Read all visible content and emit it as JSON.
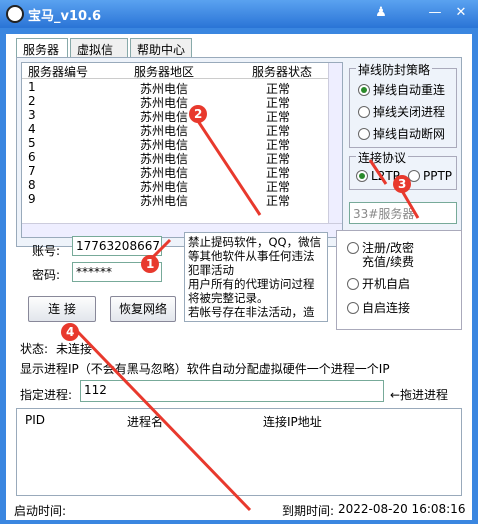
{
  "window": {
    "title": "宝马_v10.6",
    "min_label": "—",
    "close_label": "✕",
    "skin_label": "♟"
  },
  "tabs": [
    {
      "label": "服务器"
    },
    {
      "label": "虚拟信息"
    },
    {
      "label": "帮助中心"
    }
  ],
  "server_list": {
    "columns": [
      "服务器编号",
      "服务器地区",
      "服务器状态"
    ],
    "rows": [
      {
        "id": "1",
        "region": "苏州电信",
        "status": "正常"
      },
      {
        "id": "2",
        "region": "苏州电信",
        "status": "正常"
      },
      {
        "id": "3",
        "region": "苏州电信",
        "status": "正常"
      },
      {
        "id": "4",
        "region": "苏州电信",
        "status": "正常"
      },
      {
        "id": "5",
        "region": "苏州电信",
        "status": "正常"
      },
      {
        "id": "6",
        "region": "苏州电信",
        "status": "正常"
      },
      {
        "id": "7",
        "region": "苏州电信",
        "status": "正常"
      },
      {
        "id": "8",
        "region": "苏州电信",
        "status": "正常"
      },
      {
        "id": "9",
        "region": "苏州电信",
        "status": "正常"
      }
    ]
  },
  "strategy": {
    "title": "掉线防封策略",
    "options": [
      "掉线自动重连",
      "掉线关闭进程",
      "掉线自动断网"
    ],
    "selected": 0
  },
  "protocol": {
    "title": "连接协议",
    "options": [
      "L2TP",
      "PPTP"
    ],
    "selected": 0
  },
  "server_input": {
    "value": "33#服务器"
  },
  "account": {
    "label": "账号:",
    "value": "17763208667"
  },
  "password": {
    "label": "密码:",
    "value": "******"
  },
  "buttons": {
    "connect": "连 接",
    "restore": "恢复网络",
    "add": "←拖进进程"
  },
  "notice": "禁止提码软件，QQ，微信等其他软件从事任何违法犯罪活动\n用户所有的代理访问过程将被完整记录。\n若帐号存在非法活动，造",
  "side_options": {
    "register": "注册/改密\n充值/续费",
    "autostart": "开机自启",
    "autoconnect": "自启连接"
  },
  "status": {
    "label": "状态:",
    "value": "未连接"
  },
  "info_line": "显示进程IP（不会有黑马忽略）软件自动分配虚拟硬件一个进程一个IP",
  "process": {
    "label": "指定进程:",
    "value": "112"
  },
  "pid_list": {
    "columns": [
      "PID",
      "进程名",
      "连接IP地址"
    ]
  },
  "footer": {
    "start_label": "启动时间:",
    "expire_label": "到期时间:",
    "expire_value": "2022-08-20 16:08:16"
  },
  "annotations": [
    "1",
    "2",
    "3",
    "4"
  ],
  "colors": {
    "titlebar": "#2a74d6",
    "annotation": "#e8392d"
  }
}
